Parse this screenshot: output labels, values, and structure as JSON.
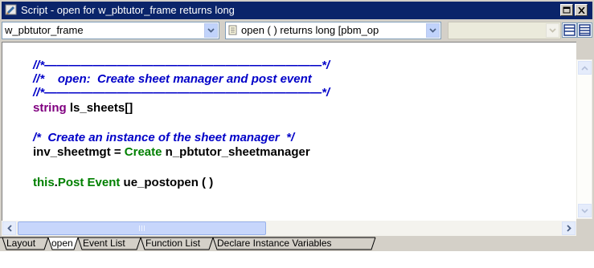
{
  "window": {
    "title": "Script - open for w_pbtutor_frame returns long"
  },
  "toolbar": {
    "object_select": "w_pbtutor_frame",
    "event_select": "open ( )  returns long [pbm_op"
  },
  "code": [
    {
      "parts": [
        {
          "cls": "c-comment",
          "text": "//*———————————————————————*/"
        }
      ]
    },
    {
      "parts": [
        {
          "cls": "c-comment",
          "text": "//*    open:  Create sheet manager and post event"
        }
      ]
    },
    {
      "parts": [
        {
          "cls": "c-comment",
          "text": "//*———————————————————————*/"
        }
      ]
    },
    {
      "parts": [
        {
          "cls": "c-type",
          "text": "string"
        },
        {
          "cls": "c-plain",
          "text": " ls_sheets[]"
        }
      ]
    },
    {
      "parts": []
    },
    {
      "parts": [
        {
          "cls": "c-comment",
          "text": "/*  Create an instance of the sheet manager  */"
        }
      ]
    },
    {
      "parts": [
        {
          "cls": "c-plain",
          "text": "inv_sheetmgt = "
        },
        {
          "cls": "c-kw",
          "text": "Create"
        },
        {
          "cls": "c-plain",
          "text": " n_pbtutor_sheetmanager"
        }
      ]
    },
    {
      "parts": []
    },
    {
      "parts": [
        {
          "cls": "c-kw",
          "text": "this"
        },
        {
          "cls": "c-plain",
          "text": "."
        },
        {
          "cls": "c-kw",
          "text": "Post Event"
        },
        {
          "cls": "c-plain",
          "text": " ue_postopen ( )"
        }
      ]
    }
  ],
  "tabs": [
    {
      "label": "Layout",
      "active": false
    },
    {
      "label": "open",
      "active": true
    },
    {
      "label": "Event List",
      "active": false
    },
    {
      "label": "Function List",
      "active": false
    },
    {
      "label": "Declare Instance Variables",
      "active": false
    }
  ],
  "colors": {
    "title_bar": "#0a246a",
    "comment": "#0000c8",
    "type_keyword": "#800080",
    "keyword": "#008000"
  },
  "icons": {
    "title": "script-icon",
    "restore": "restore-icon",
    "close": "close-icon",
    "event": "event-script-icon",
    "view1": "single-pane-icon",
    "view2": "split-pane-icon"
  }
}
